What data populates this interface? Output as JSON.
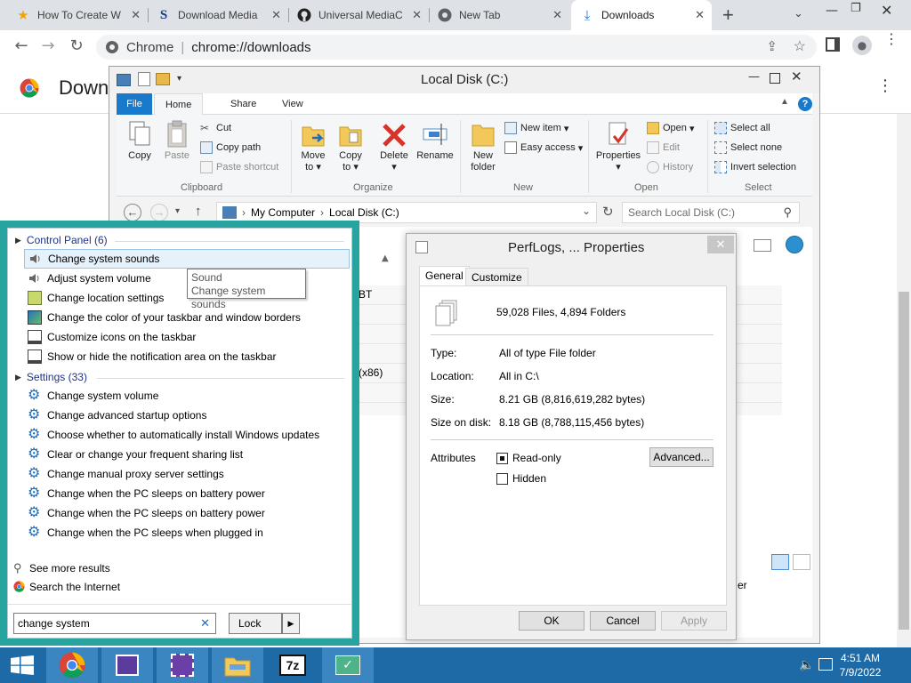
{
  "browser": {
    "tabs": [
      {
        "label": "How To Create W",
        "icon": "star-icon"
      },
      {
        "label": "Download Media",
        "icon": "s-logo-icon"
      },
      {
        "label": "Universal MediaC",
        "icon": "github-icon"
      },
      {
        "label": "New Tab",
        "icon": "chrome-icon"
      },
      {
        "label": "Downloads",
        "icon": "download-icon"
      }
    ],
    "omnibox_site": "Chrome",
    "omnibox_url": "chrome://downloads",
    "page_title_partial": "Down"
  },
  "explorer": {
    "title": "Local Disk (C:)",
    "tabs": [
      "File",
      "Home",
      "Share",
      "View"
    ],
    "clipboard": {
      "copy": "Copy",
      "paste": "Paste",
      "cut": "Cut",
      "copy_path": "Copy path",
      "paste_shortcut": "Paste shortcut",
      "label": "Clipboard"
    },
    "organize": {
      "move_to": "Move",
      "move_to2": "to",
      "copy_to": "Copy",
      "copy_to2": "to",
      "delete": "Delete",
      "rename": "Rename",
      "label": "Organize"
    },
    "new": {
      "new_folder": "New",
      "new_folder2": "folder",
      "new_item": "New item",
      "easy_access": "Easy access",
      "label": "New"
    },
    "open": {
      "properties": "Properties",
      "open": "Open",
      "edit": "Edit",
      "history": "History",
      "label": "Open"
    },
    "select": {
      "select_all": "Select all",
      "select_none": "Select none",
      "invert": "Invert selection",
      "label": "Select"
    },
    "address": {
      "root": "My Computer",
      "current": "Local Disk (C:)"
    },
    "search_placeholder": "Search Local Disk (C:)",
    "partial_items": [
      "BT",
      "(x86)"
    ],
    "partial_status": "er"
  },
  "search_pane": {
    "control_panel_header": "Control Panel (6)",
    "control_panel_items": [
      "Change system sounds",
      "Adjust system volume",
      "Change location settings",
      "Change the color of your taskbar and window borders",
      "Customize icons on the taskbar",
      "Show or hide the notification area on the taskbar"
    ],
    "settings_header": "Settings (33)",
    "settings_items": [
      "Change system volume",
      "Change advanced startup options",
      "Choose whether to automatically install Windows updates",
      "Clear or change your frequent sharing list",
      "Change manual proxy server settings",
      "Change when the PC sleeps on battery power",
      "Change when the PC sleeps on battery power",
      "Change when the PC sleeps when plugged in"
    ],
    "see_more": "See more results",
    "search_internet": "Search the Internet",
    "query": "change system",
    "lock_label": "Lock",
    "tooltip": {
      "line1": "Sound",
      "line2": "Change system sounds"
    }
  },
  "properties": {
    "title": "PerfLogs, ... Properties",
    "tabs": [
      "General",
      "Customize"
    ],
    "summary": "59,028 Files, 4,894 Folders",
    "rows": [
      {
        "label": "Type:",
        "value": "All of type File folder"
      },
      {
        "label": "Location:",
        "value": "All in C:\\"
      },
      {
        "label": "Size:",
        "value": "8.21 GB (8,816,619,282 bytes)"
      },
      {
        "label": "Size on disk:",
        "value": "8.18 GB (8,788,115,456 bytes)"
      }
    ],
    "attributes_label": "Attributes",
    "readonly_label": "Read-only",
    "hidden_label": "Hidden",
    "advanced_label": "Advanced...",
    "ok": "OK",
    "cancel": "Cancel",
    "apply": "Apply"
  },
  "taskbar": {
    "time": "4:51 AM",
    "date": "7/9/2022"
  }
}
